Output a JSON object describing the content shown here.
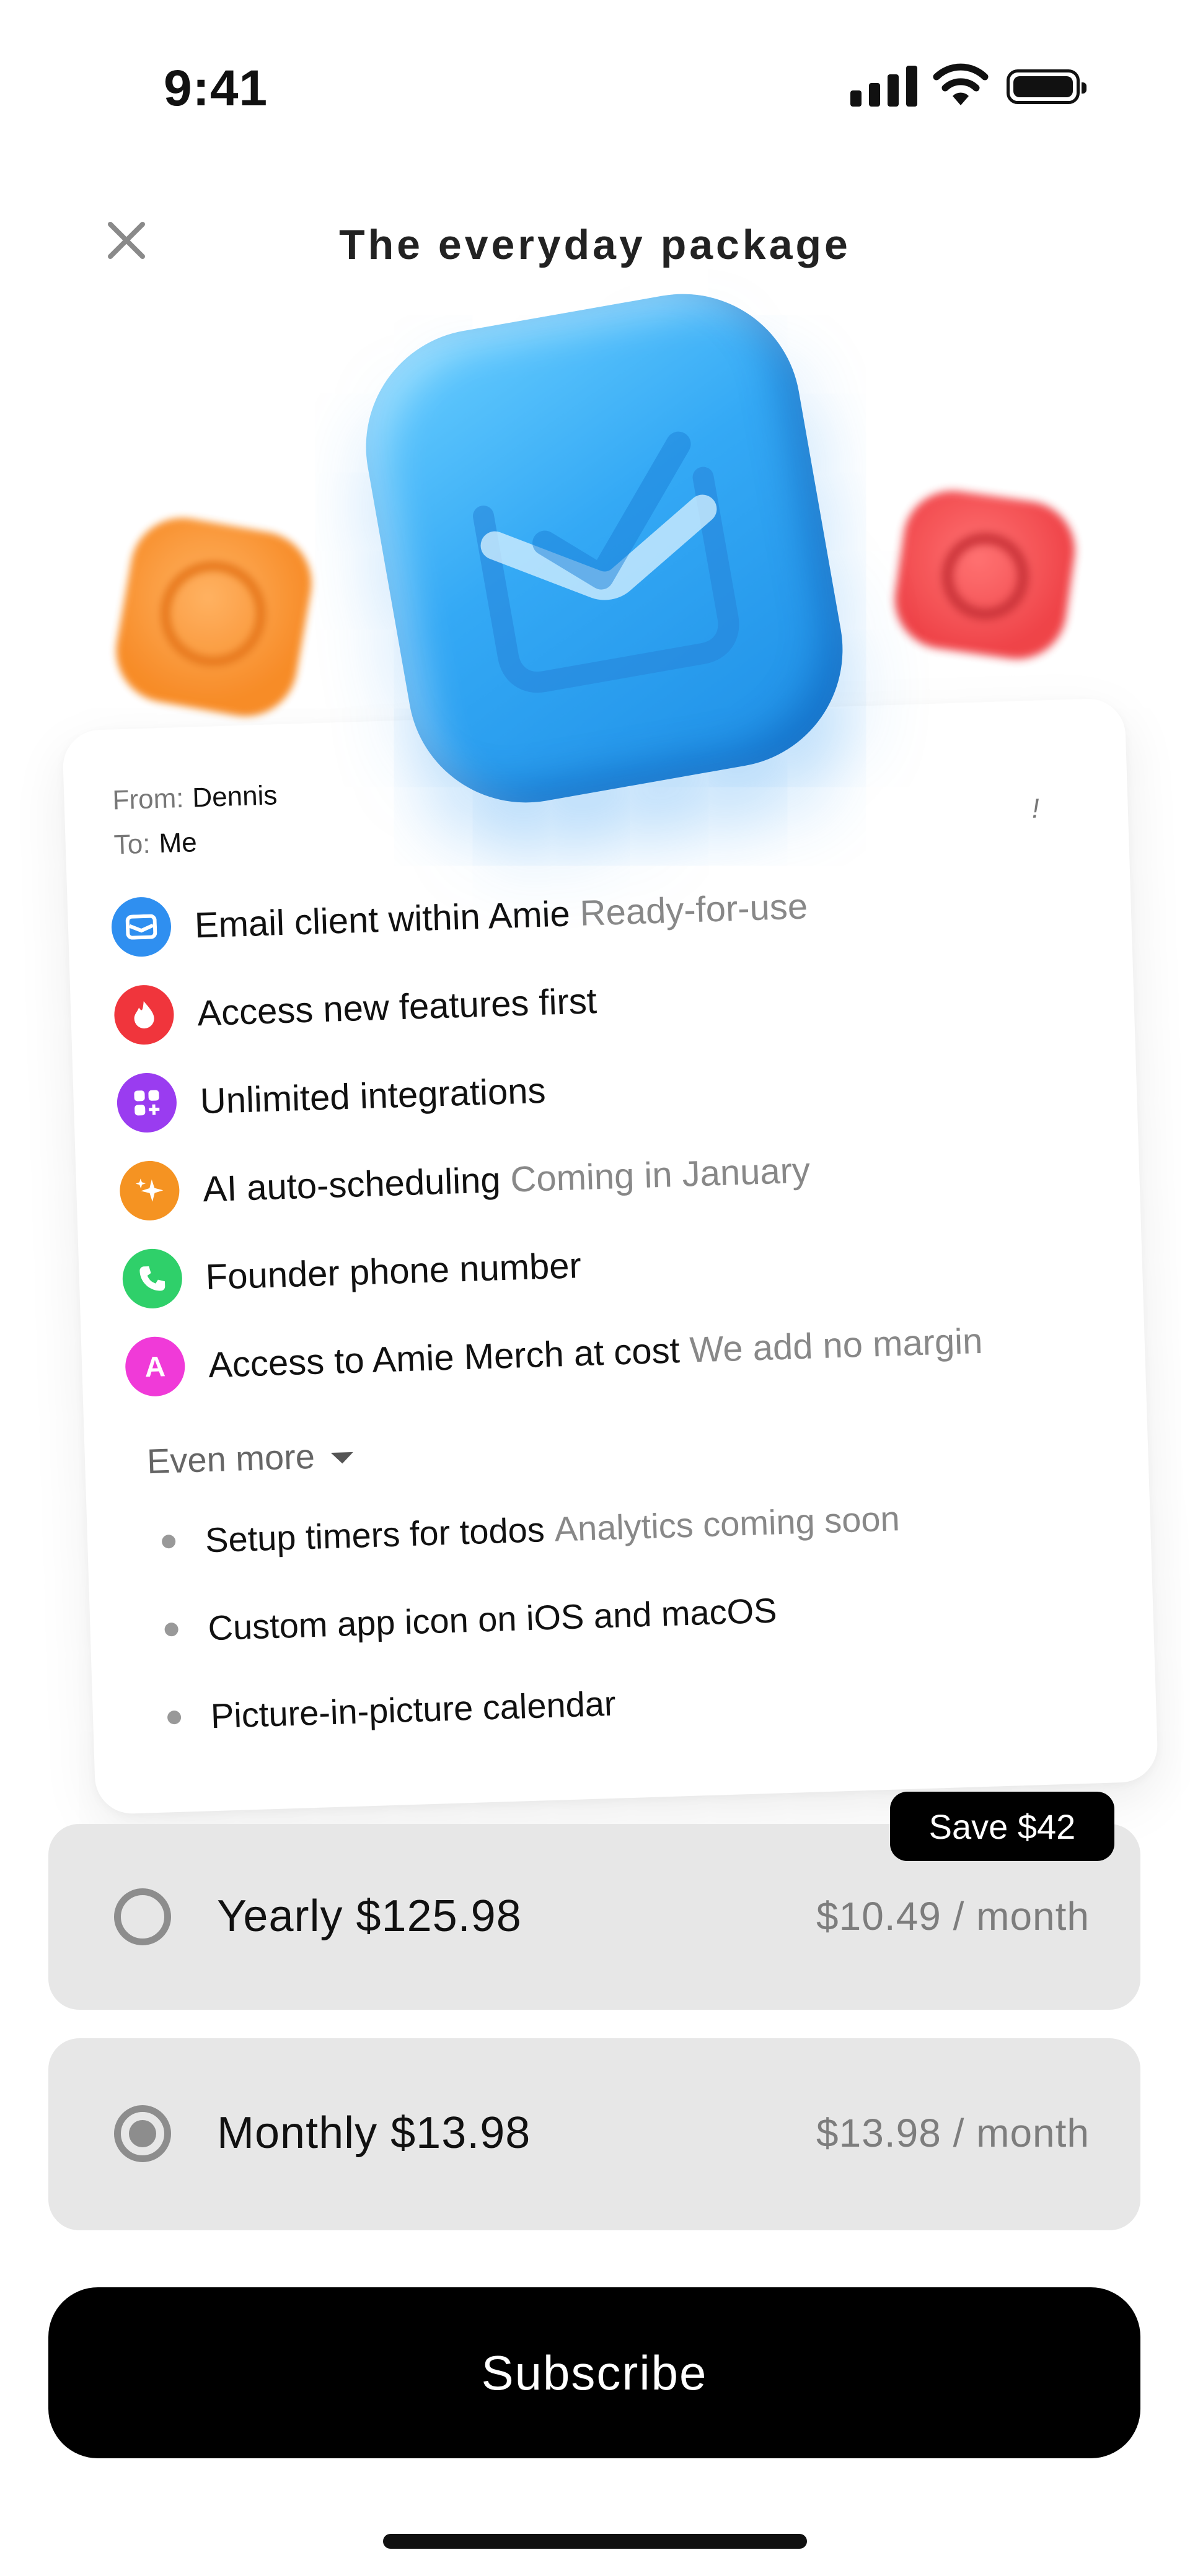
{
  "status_bar": {
    "time": "9:41"
  },
  "header": {
    "title": "The everyday package"
  },
  "card": {
    "from_label": "From:",
    "from_value": "Dennis",
    "to_label": "To:",
    "to_value": "Me",
    "mark": "!",
    "features": [
      {
        "label": "Email client within Amie",
        "note": "Ready-for-use",
        "icon": "mail-icon",
        "color": "#2f8ff0"
      },
      {
        "label": "Access new features first",
        "note": "",
        "icon": "flame-icon",
        "color": "#f0353c"
      },
      {
        "label": "Unlimited integrations",
        "note": "",
        "icon": "grid-icon",
        "color": "#9a3cf0"
      },
      {
        "label": "AI auto-scheduling",
        "note": "Coming in January",
        "icon": "sparkle-icon",
        "color": "#f59322"
      },
      {
        "label": "Founder phone number",
        "note": "",
        "icon": "phone-icon",
        "color": "#2fd06a"
      },
      {
        "label": "Access to Amie Merch at cost",
        "note": "We add no margin",
        "icon": "letter-a-icon",
        "color": "#f03ad8",
        "glyph": "A"
      }
    ],
    "even_more": "Even more",
    "extras": [
      {
        "label": "Setup timers for todos",
        "note": "Analytics coming soon"
      },
      {
        "label": "Custom app icon on iOS and macOS",
        "note": ""
      },
      {
        "label": "Picture-in-picture calendar",
        "note": ""
      }
    ]
  },
  "plans": {
    "save_badge": "Save $42",
    "yearly": {
      "label": "Yearly $125.98",
      "per_month": "$10.49 / month",
      "selected": false
    },
    "monthly": {
      "label": "Monthly $13.98",
      "per_month": "$13.98 / month",
      "selected": true
    }
  },
  "cta": {
    "subscribe": "Subscribe"
  }
}
